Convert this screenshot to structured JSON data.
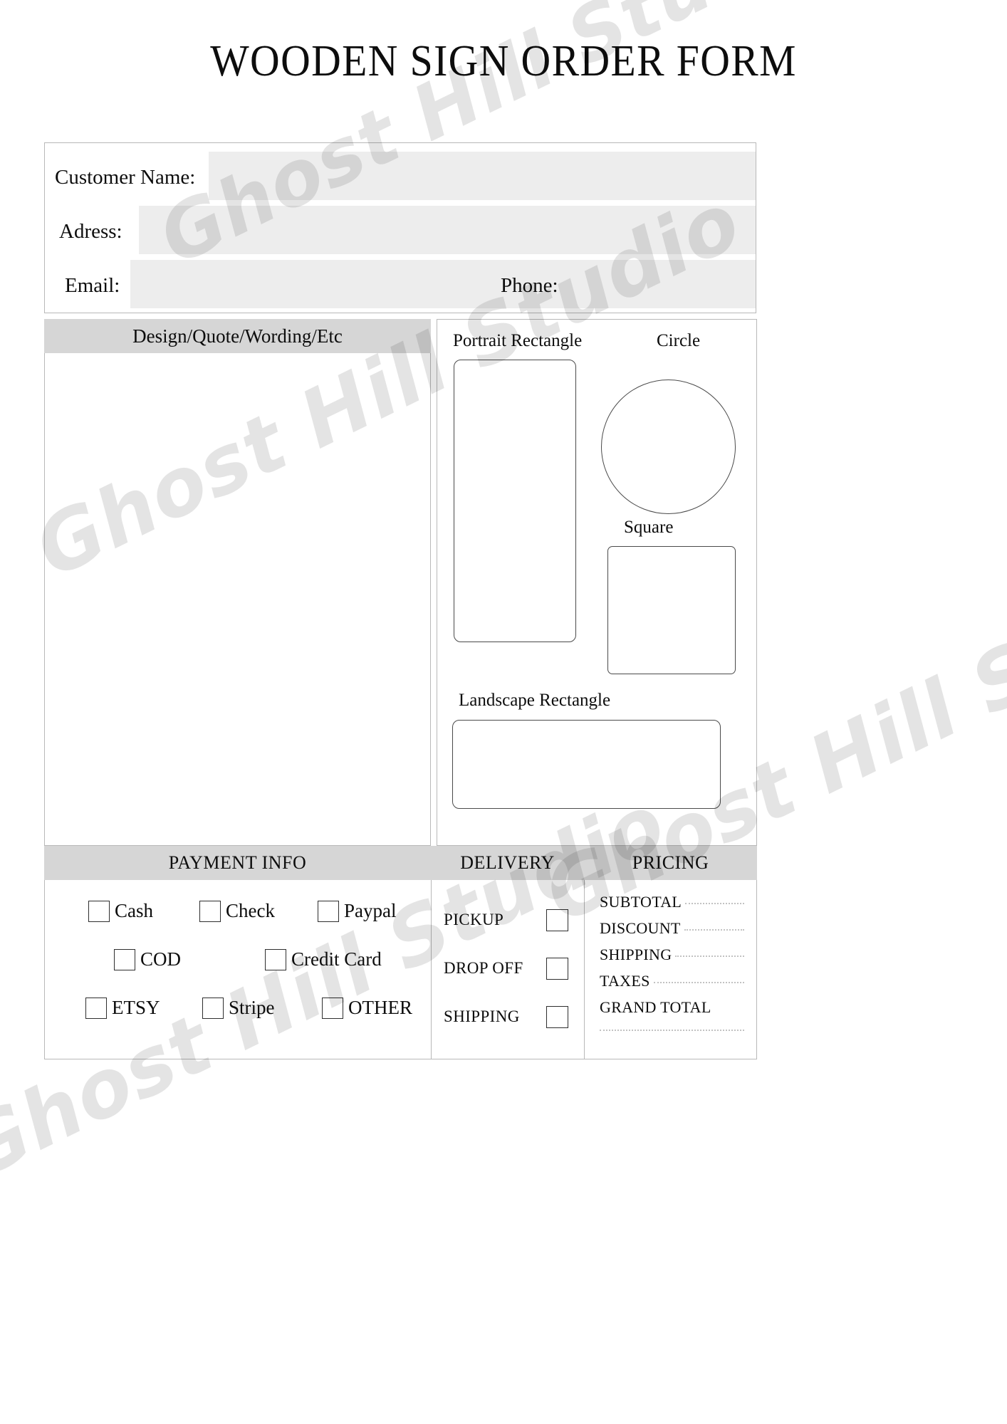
{
  "document": {
    "title": "WOODEN SIGN ORDER FORM",
    "watermark": "Ghost Hill Studio"
  },
  "customer": {
    "name_label": "Customer Name:",
    "name_value": "",
    "address_label": "Adress:",
    "address_value": "",
    "email_label": "Email:",
    "email_value": "",
    "phone_label": "Phone:",
    "phone_value": ""
  },
  "design": {
    "header": "Design/Quote/Wording/Etc",
    "notes_value": ""
  },
  "shapes": {
    "portrait_label": "Portrait Rectangle",
    "circle_label": "Circle",
    "square_label": "Square",
    "landscape_label": "Landscape Rectangle"
  },
  "bottom": {
    "payment_header": "PAYMENT INFO",
    "delivery_header": "DELIVERY",
    "pricing_header": "PRICING"
  },
  "payment_options": [
    {
      "label": "Cash",
      "checked": false
    },
    {
      "label": "Check",
      "checked": false
    },
    {
      "label": "Paypal",
      "checked": false
    },
    {
      "label": "COD",
      "checked": false
    },
    {
      "label": "Credit Card",
      "checked": false
    },
    {
      "label": "ETSY",
      "checked": false
    },
    {
      "label": "Stripe",
      "checked": false
    },
    {
      "label": "OTHER",
      "checked": false
    }
  ],
  "delivery_options": [
    {
      "label": "PICKUP",
      "checked": false
    },
    {
      "label": "DROP OFF",
      "checked": false
    },
    {
      "label": "SHIPPING",
      "checked": false
    }
  ],
  "pricing_rows": [
    {
      "label": "SUBTOTAL",
      "value": ""
    },
    {
      "label": "DISCOUNT",
      "value": ""
    },
    {
      "label": "SHIPPING",
      "value": ""
    },
    {
      "label": "TAXES",
      "value": ""
    },
    {
      "label": "GRAND  TOTAL",
      "value": ""
    }
  ],
  "colors": {
    "field_fill": "#ededed",
    "header_band": "#d6d6d6",
    "border": "#b8b8b8",
    "shape_stroke": "#4a4a4a",
    "watermark": "rgba(0,0,0,0.105)"
  }
}
